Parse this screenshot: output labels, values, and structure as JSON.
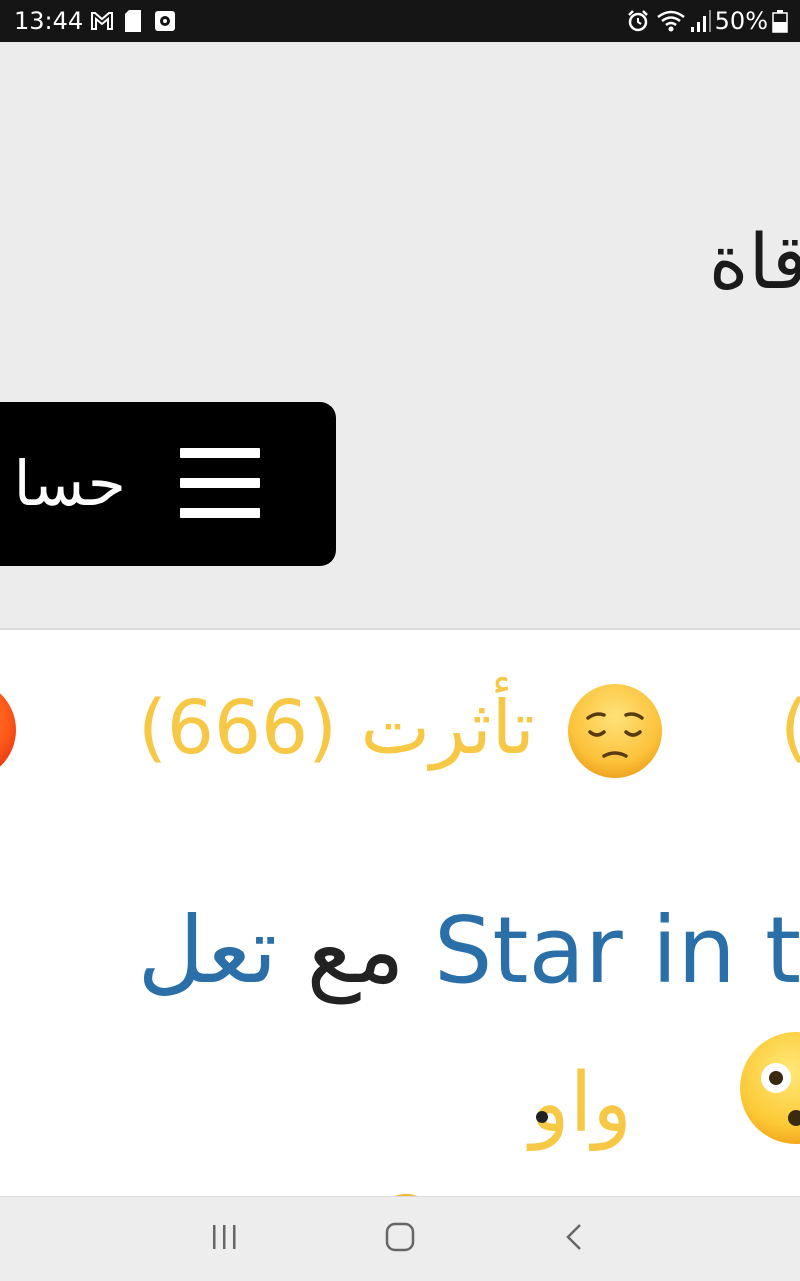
{
  "status_bar": {
    "time": "13:44",
    "battery": "50%",
    "icons": [
      "gmail-icon",
      "sd-card-icon",
      "app-icon",
      "alarm-icon",
      "wifi-icon",
      "signal-icon",
      "battery-icon"
    ]
  },
  "page": {
    "title": "قاة",
    "menu_label": "حسا"
  },
  "reactions": {
    "label": "تأثرت",
    "count": "(666)",
    "left_partial": "(",
    "color": "#f7c845"
  },
  "comment": {
    "prefix": "تعل",
    "with": "مع",
    "link_text": "Star in the da",
    "reaction_word": "واو"
  },
  "colors": {
    "link": "#2a6fa8",
    "reaction": "#f7c845",
    "menu_bg": "#000000",
    "page_bg": "#ececec"
  }
}
